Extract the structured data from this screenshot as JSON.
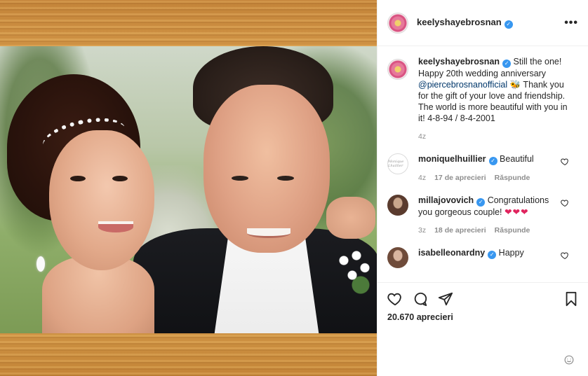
{
  "post": {
    "username": "keelyshayebrosnan",
    "verified_badge": "✓",
    "more_label": "•••",
    "caption_start": "Still the one! Happy 20th wedding anniversary ",
    "caption_mention": "@piercebrosnanofficial",
    "caption_emoji": "🐝",
    "caption_end": " Thank you for the gift of your love and friendship. The world is more beautiful with you in it! 4-8-94 / 8-4-2001",
    "caption_age": "4z"
  },
  "comments": [
    {
      "username": "moniquelhuillier",
      "text": "Beautiful",
      "age": "4z",
      "likes": "17 de aprecieri",
      "reply": "Răspunde",
      "avatar_text": "Monique Lhuillier"
    },
    {
      "username": "millajovovich",
      "text": "Congratulations you gorgeous couple!",
      "emoji": "❤❤❤",
      "age": "3z",
      "likes": "18 de aprecieri",
      "reply": "Răspunde"
    },
    {
      "username": "isabelleonardny",
      "text": "Happy"
    }
  ],
  "actions": {
    "like_icon": "heart-outline-icon",
    "comment_icon": "comment-bubble-icon",
    "share_icon": "paper-plane-icon",
    "save_icon": "bookmark-icon",
    "add_comment_icon": "add-comment-icon"
  },
  "likes_count": "20.670 aprecieri",
  "colors": {
    "accent_verified": "#3897f0",
    "mention": "#00376b",
    "heart_red": "#e0245e",
    "muted": "#8e8e8e"
  }
}
